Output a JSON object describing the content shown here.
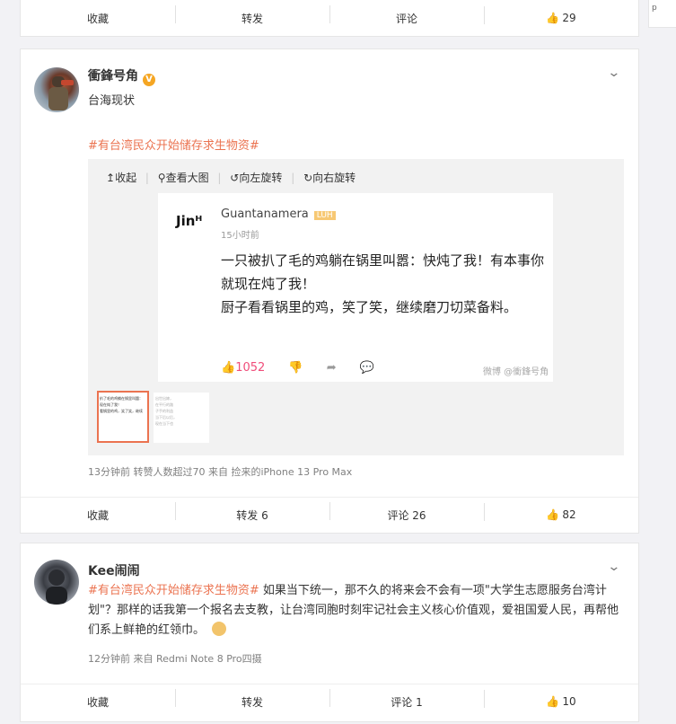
{
  "top_actions": {
    "collect": "收藏",
    "forward": "转发",
    "comment": "评论",
    "like": "29"
  },
  "side_text": "p",
  "post1": {
    "username": "衝鋒号角",
    "text": "台海现状",
    "topic": "#有台湾民众开始储存求生物资#",
    "media_toolbar": {
      "collapse": "收起",
      "view_large": "查看大图",
      "rotate_left": "向左旋转",
      "rotate_right": "向右旋转"
    },
    "embedded": {
      "logo": "Jinᴴ",
      "author": "Guantanamera",
      "badge": "LUH",
      "time": "15小时前",
      "line1": "一只被扒了毛的鸡躺在锅里叫嚣：快炖了我！有本事你就现在炖了我！",
      "line2": "厨子看看锅里的鸡，笑了笑，继续磨刀切菜备料。",
      "likes": "1052",
      "watermark": "微博 @衝鋒号角"
    },
    "thumb1_lines": [
      "扒了毛的鸡躺在锅里叫嚣：",
      "现在炖了我！",
      "看锅里的鸡，笑了笑，继续"
    ],
    "thumb2_lines": [
      "出世出嫁，",
      "在平行的路",
      "子手的利益",
      "当下后以后，",
      "现在当下也"
    ],
    "meta": "13分钟前 转赞人数超过70 来自 捡来的iPhone 13 Pro Max",
    "actions": {
      "collect": "收藏",
      "forward": "转发 6",
      "comment": "评论 26",
      "like": "82"
    }
  },
  "post2": {
    "username": "Kee闹闹",
    "topic": "#有台湾民众开始储存求生物资#",
    "text": " 如果当下统一，那不久的将来会不会有一项\"大学生志愿服务台湾计划\"？那样的话我第一个报名去支教，让台湾同胞时刻牢记社会主义核心价值观，爱祖国爱人民，再帮他们系上鲜艳的红领巾。",
    "meta": "12分钟前  来自 Redmi Note 8 Pro四摄",
    "actions": {
      "collect": "收藏",
      "forward": "转发",
      "comment": "评论 1",
      "like": "10"
    }
  },
  "colors": {
    "accent": "#eb7350",
    "link": "#4e88d8",
    "like_pink": "#f04d7a"
  }
}
